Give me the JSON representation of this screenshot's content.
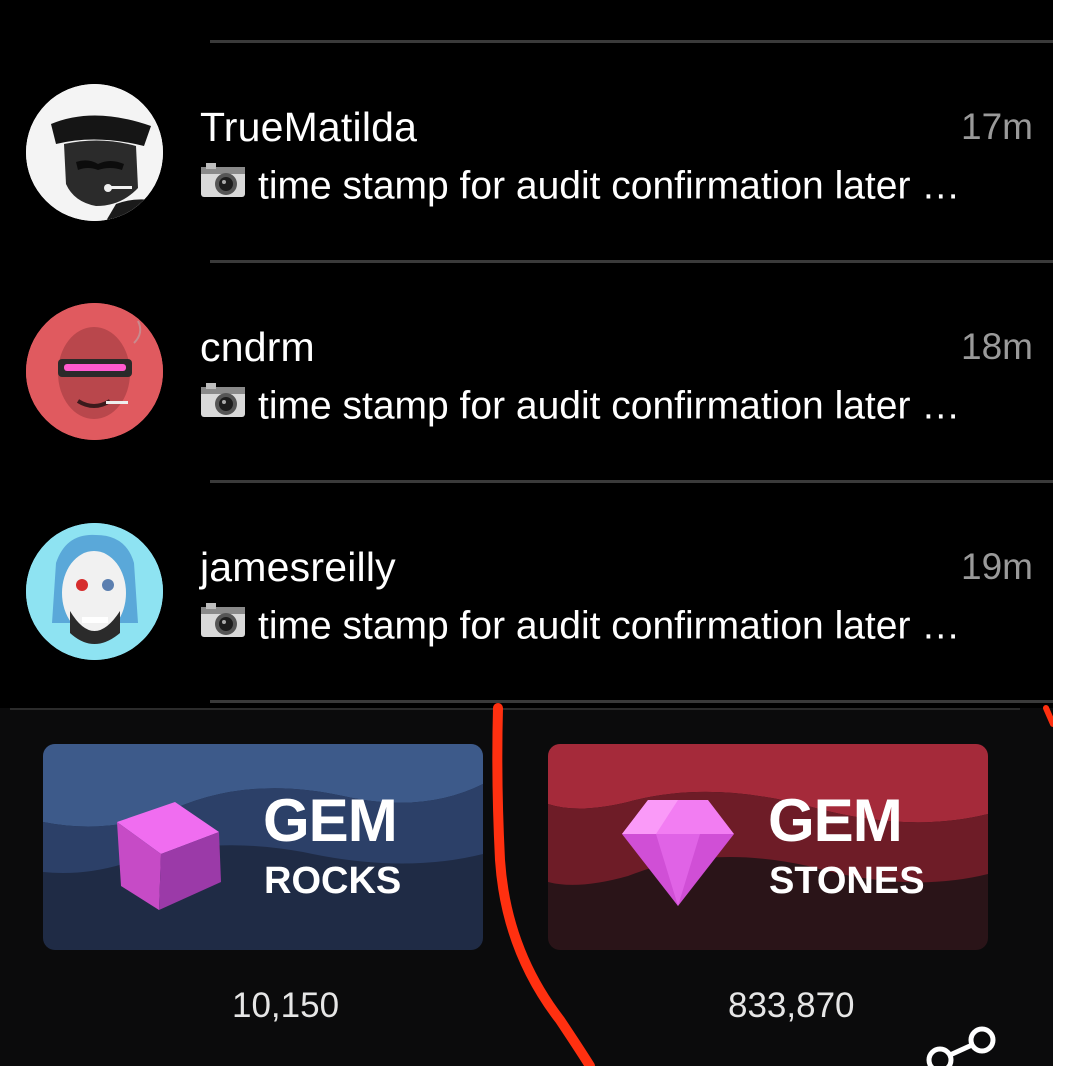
{
  "chats": [
    {
      "name": "TrueMatilda",
      "time": "17m",
      "preview": "time stamp for audit confirmation later …",
      "preview_icon": "camera-icon",
      "avatar_color": "#ffffff"
    },
    {
      "name": "cndrm",
      "time": "18m",
      "preview": "time stamp for audit confirmation later …",
      "preview_icon": "camera-icon",
      "avatar_color": "#e05a5f"
    },
    {
      "name": "jamesreilly",
      "time": "19m",
      "preview": "time stamp for audit confirmation later …",
      "preview_icon": "camera-icon",
      "avatar_color": "#8ee3f2"
    }
  ],
  "wallet": {
    "rocks": {
      "title": "GEM",
      "subtitle": "ROCKS",
      "count": "10,150",
      "color": "#2a3a5c"
    },
    "stones": {
      "title": "GEM",
      "subtitle": "STONES",
      "count": "833,870",
      "color": "#8a2331"
    }
  },
  "colors": {
    "annotation": "#ff3010",
    "gem": "#e54fe0"
  }
}
